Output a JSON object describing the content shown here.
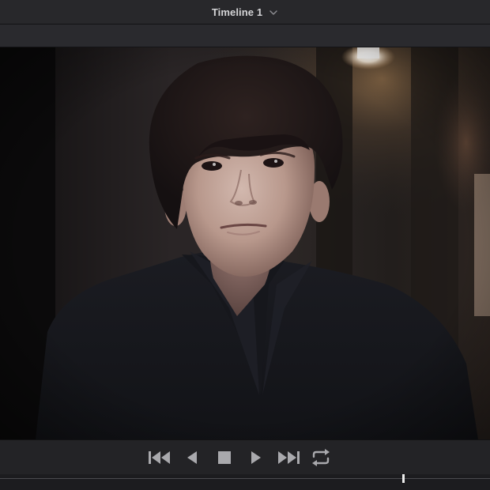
{
  "titlebar": {
    "title": "Timeline 1",
    "dropdown_icon": "chevron-down-icon"
  },
  "viewer": {
    "content": "video-frame",
    "icon": "video-frame-image"
  },
  "transport": {
    "buttons": [
      {
        "id": "go-to-start",
        "icon": "skip-to-start-icon"
      },
      {
        "id": "play-reverse",
        "icon": "play-reverse-icon"
      },
      {
        "id": "stop",
        "icon": "stop-icon"
      },
      {
        "id": "play",
        "icon": "play-icon"
      },
      {
        "id": "go-to-end",
        "icon": "skip-to-end-icon"
      },
      {
        "id": "loop",
        "icon": "loop-icon"
      }
    ],
    "icon_color": "#a9a9ad"
  },
  "scrubber": {
    "playhead_position": 0.823,
    "playhead_color": "#ececec"
  },
  "colors": {
    "panel": "#28282b",
    "toolbar": "#2a2a2e",
    "background": "#1e1e20",
    "text": "#d4d4d6"
  }
}
